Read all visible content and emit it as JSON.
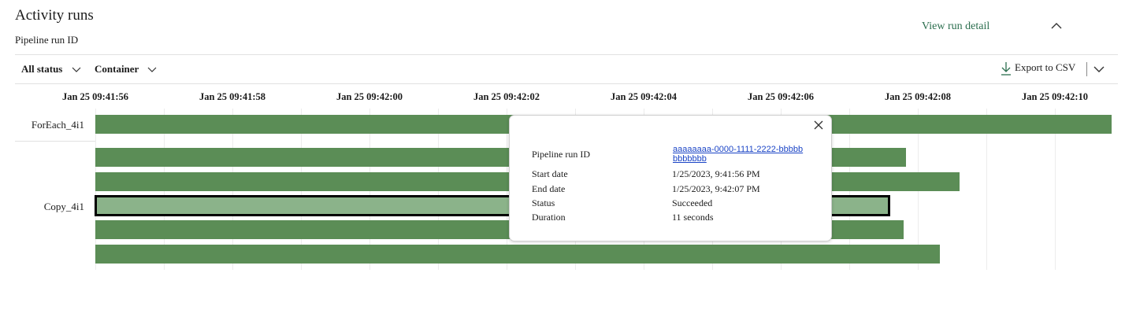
{
  "header": {
    "title": "Activity runs",
    "subtitle": "Pipeline run ID",
    "view_run_detail": "View run detail"
  },
  "filters": {
    "status": "All status",
    "container": "Container"
  },
  "toolbar": {
    "export_label": "Export to CSV"
  },
  "timeline": {
    "ticks": [
      "Jan 25 09:41:56",
      "Jan 25 09:41:58",
      "Jan 25 09:42:00",
      "Jan 25 09:42:02",
      "Jan 25 09:42:04",
      "Jan 25 09:42:06",
      "Jan 25 09:42:08",
      "Jan 25 09:42:10"
    ],
    "rows": [
      {
        "label": "ForEach_4i1"
      },
      {
        "label": "Copy_4i1"
      }
    ]
  },
  "tooltip": {
    "fields": [
      {
        "label": "Pipeline run ID",
        "value": "aaaaaaaa-0000-1111-2222-bbbbbbbbbbbb"
      },
      {
        "label": "Start date",
        "value": "1/25/2023, 9:41:56 PM"
      },
      {
        "label": "End date",
        "value": "1/25/2023, 9:42:07 PM"
      },
      {
        "label": "Status",
        "value": "Succeeded"
      },
      {
        "label": "Duration",
        "value": "11 seconds"
      }
    ]
  },
  "colors": {
    "bar": "#5b8d56",
    "bar_selected": "#8bb38a",
    "link": "#2b6e4e"
  }
}
